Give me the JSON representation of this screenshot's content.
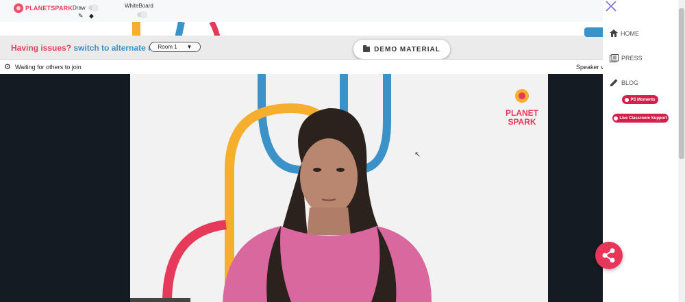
{
  "topbar": {
    "logo_text": "PLANETSPARK",
    "draw_label": "Draw",
    "whiteboard_label": "WhiteBoard",
    "icons": {
      "pencil": "pencil-icon",
      "eraser": "eraser-icon"
    }
  },
  "strip": {
    "issues_text": "Having issues?",
    "alternate_link": "switch to alternate room",
    "room_value": "Room 1",
    "room_arrow": "▼",
    "demo_label": "DEMO MATERIAL"
  },
  "status": {
    "waiting": "Waiting for others to join",
    "speaker_view": "Speaker vi"
  },
  "video": {
    "watermark_line1": "PLANET",
    "watermark_line2": "SPARK",
    "cursor": "↖"
  },
  "sidepanel": {
    "nav": [
      {
        "label": "HOME",
        "icon": "home-icon"
      },
      {
        "label": "PRESS",
        "icon": "press-icon"
      },
      {
        "label": "BLOG",
        "icon": "edit-icon"
      }
    ],
    "ps_moments": "PS Moments",
    "live_support": "Live Classroom Support"
  },
  "colors": {
    "brand_red": "#e73f5d",
    "link_blue": "#3a92c8",
    "pill_red": "#d41f4b",
    "video_bg_dark": "#131b23",
    "arc_yellow": "#f5ae2d",
    "arc_blue": "#3a92c8",
    "arc_red": "#e73a5a"
  }
}
